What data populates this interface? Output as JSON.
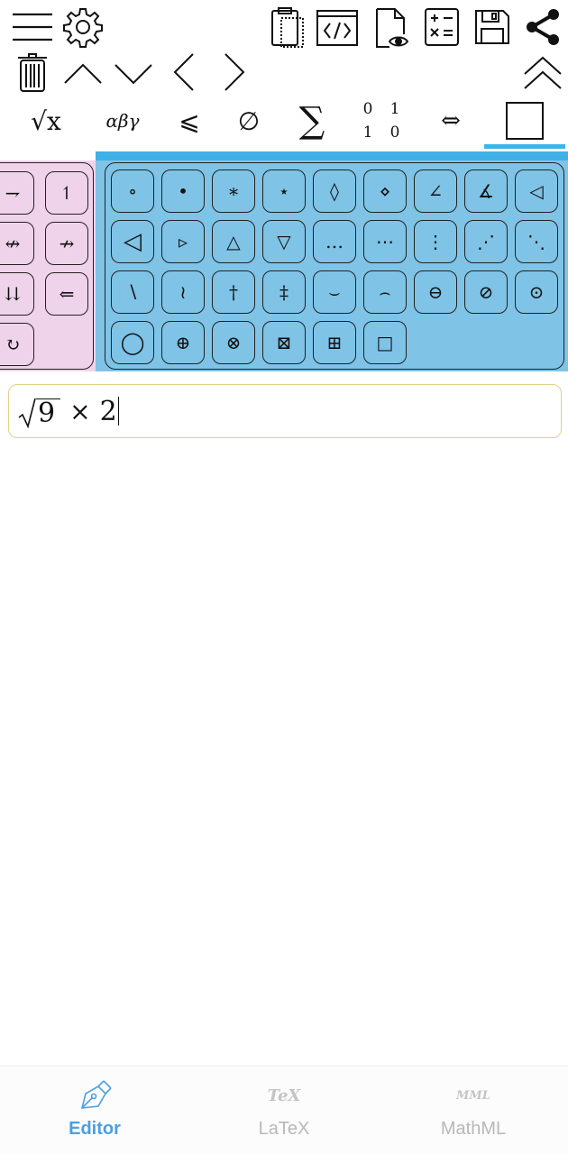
{
  "toolbar": {
    "row1": [
      "menu-icon",
      "settings-icon",
      "clipboard-icon",
      "code-icon",
      "preview-document-icon",
      "calculator-icon",
      "save-icon",
      "share-icon"
    ],
    "row2": [
      "trash-icon",
      "chevron-up-icon",
      "chevron-down-icon",
      "chevron-left-icon",
      "chevron-right-icon",
      "double-chevron-up-icon"
    ]
  },
  "categories": {
    "sqrt_label": "√x",
    "greek_label": "αβγ",
    "relations_label": "⩽",
    "sets_label": "∅",
    "sum_label": "∑",
    "matrix_r1c1": "0",
    "matrix_r1c2": "1",
    "matrix_r2c1": "1",
    "matrix_r2c2": "0",
    "arrows_label": "⇔",
    "selected": "shapes"
  },
  "pink_keys": [
    "⇁",
    "↿",
    "↮",
    "↛",
    "⇊",
    "⇐",
    "↻"
  ],
  "blue_keys": {
    "row1": [
      "∘",
      "•",
      "∗",
      "⋆",
      "◊",
      "⋄",
      "∠",
      "∡",
      "◁"
    ],
    "row2": [
      "◁",
      "▹",
      "△",
      "▽",
      "…",
      "⋯",
      "⋮",
      "⋰",
      "⋱"
    ],
    "row3": [
      "∖",
      "≀",
      "†",
      "‡",
      "⌣",
      "⌢",
      "⊖",
      "⊘",
      "⊙"
    ],
    "row4": [
      "◯",
      "⊕",
      "⊗",
      "⊠",
      "⊞",
      "□"
    ]
  },
  "editor": {
    "radicand": "9",
    "operator": "×",
    "operand": "2"
  },
  "nav": {
    "editor_label": "Editor",
    "latex_label": "LaTeX",
    "latex_icon_text": "TeX",
    "mathml_label": "MathML",
    "mathml_icon_text": "MML",
    "active": "Editor",
    "active_color": "#4a9fe0",
    "inactive_color": "#b8b8b8"
  }
}
